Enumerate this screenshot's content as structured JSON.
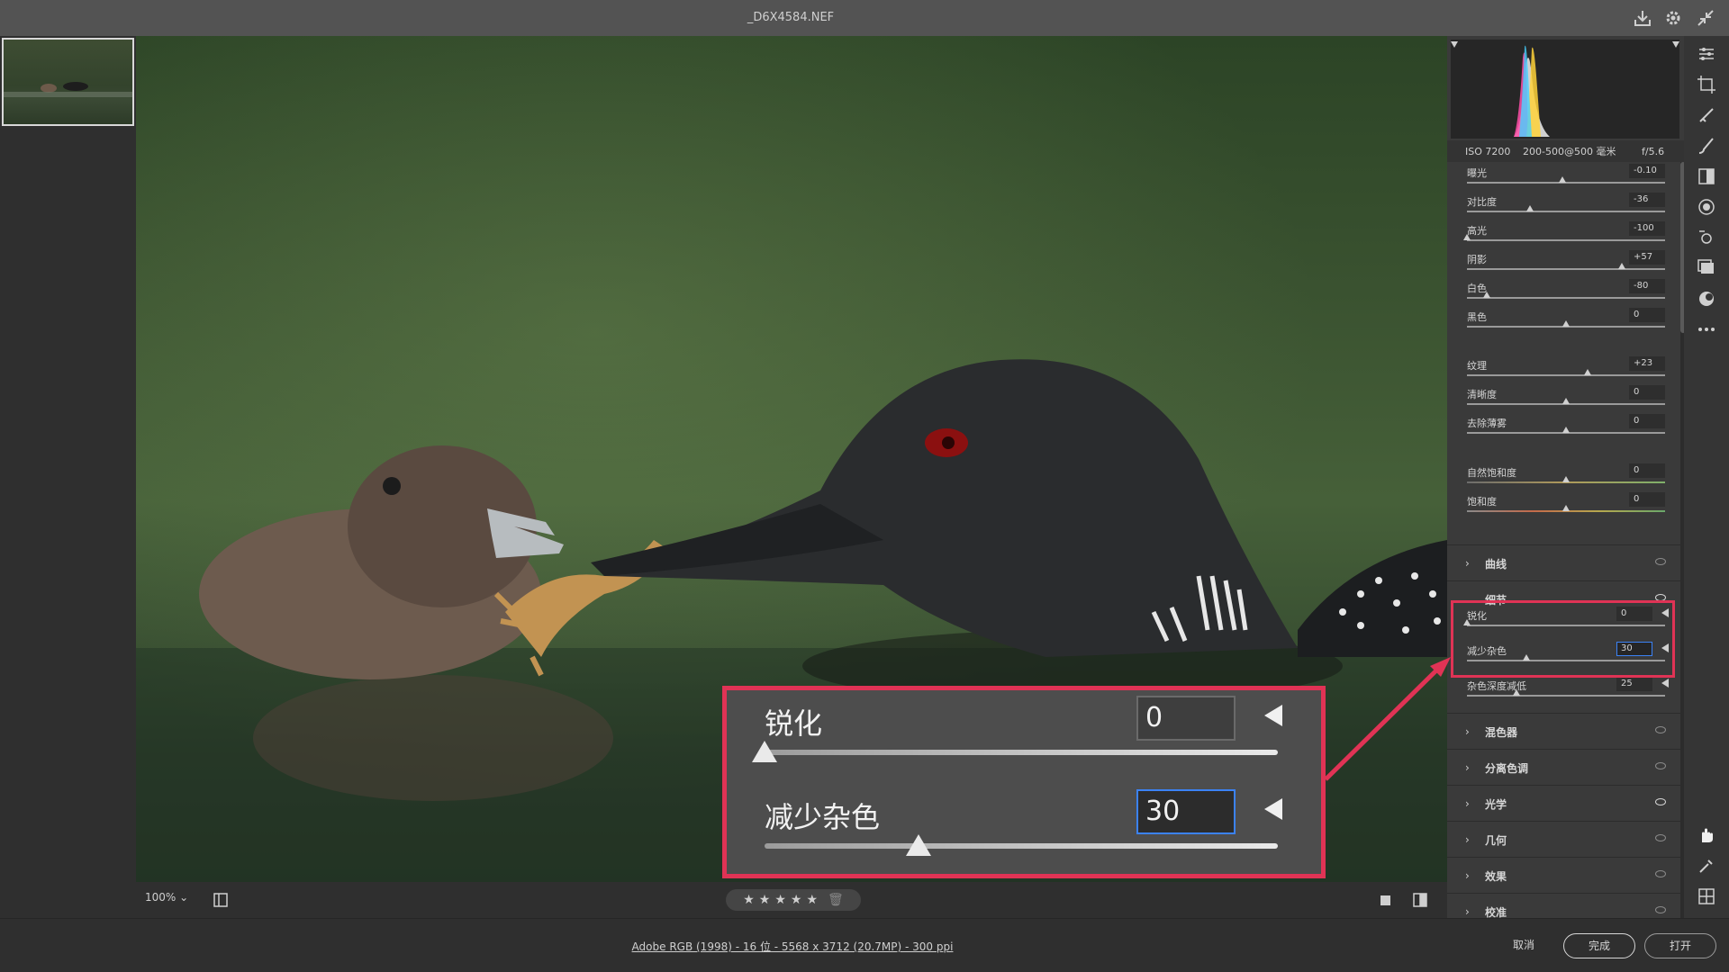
{
  "window": {
    "title": "_D6X4584.NEF"
  },
  "canvas": {
    "zoom": "100%"
  },
  "histogram": {
    "iso": "ISO 7200",
    "lens": "200-500@500 毫米",
    "aperture": "f/5.6"
  },
  "basic_sliders": [
    {
      "label": "曝光",
      "value": "-0.10",
      "level": 0.48
    },
    {
      "label": "对比度",
      "value": "-36",
      "level": 0.32
    },
    {
      "label": "高光",
      "value": "-100",
      "level": 0.0
    },
    {
      "label": "阴影",
      "value": "+57",
      "level": 0.78
    },
    {
      "label": "白色",
      "value": "-80",
      "level": 0.1
    },
    {
      "label": "黑色",
      "value": "0",
      "level": 0.5
    },
    {
      "label": "纹理",
      "value": "+23",
      "level": 0.61
    },
    {
      "label": "清晰度",
      "value": "0",
      "level": 0.5
    },
    {
      "label": "去除薄雾",
      "value": "0",
      "level": 0.5
    },
    {
      "label": "自然饱和度",
      "value": "0",
      "level": 0.5
    },
    {
      "label": "饱和度",
      "value": "0",
      "level": 0.5
    }
  ],
  "sections": {
    "curve": "曲线",
    "detail": "细节",
    "mixer": "混色器",
    "split_toning": "分离色调",
    "optics": "光学",
    "geometry": "几何",
    "effects": "效果",
    "calibration": "校准"
  },
  "detail": {
    "sharpen": {
      "label": "锐化",
      "value": "0",
      "level": 0.0
    },
    "noise": {
      "label": "减少杂色",
      "value": "30",
      "level": 0.3
    },
    "color_noise": {
      "label": "杂色深度减低",
      "value": "25",
      "level": 0.25
    }
  },
  "callout": {
    "sharpen_label": "锐化",
    "sharpen_value": "0",
    "sharpen_level": 0.0,
    "noise_label": "减少杂色",
    "noise_value": "30",
    "noise_level": 0.3
  },
  "footer": {
    "file_info": "Adobe RGB (1998) - 16 位 - 5568 x 3712 (20.7MP) - 300 ppi",
    "cancel": "取消",
    "done": "完成",
    "open": "打开"
  },
  "colors": {
    "highlight": "#e03355",
    "input_focus": "#3b82f6"
  }
}
